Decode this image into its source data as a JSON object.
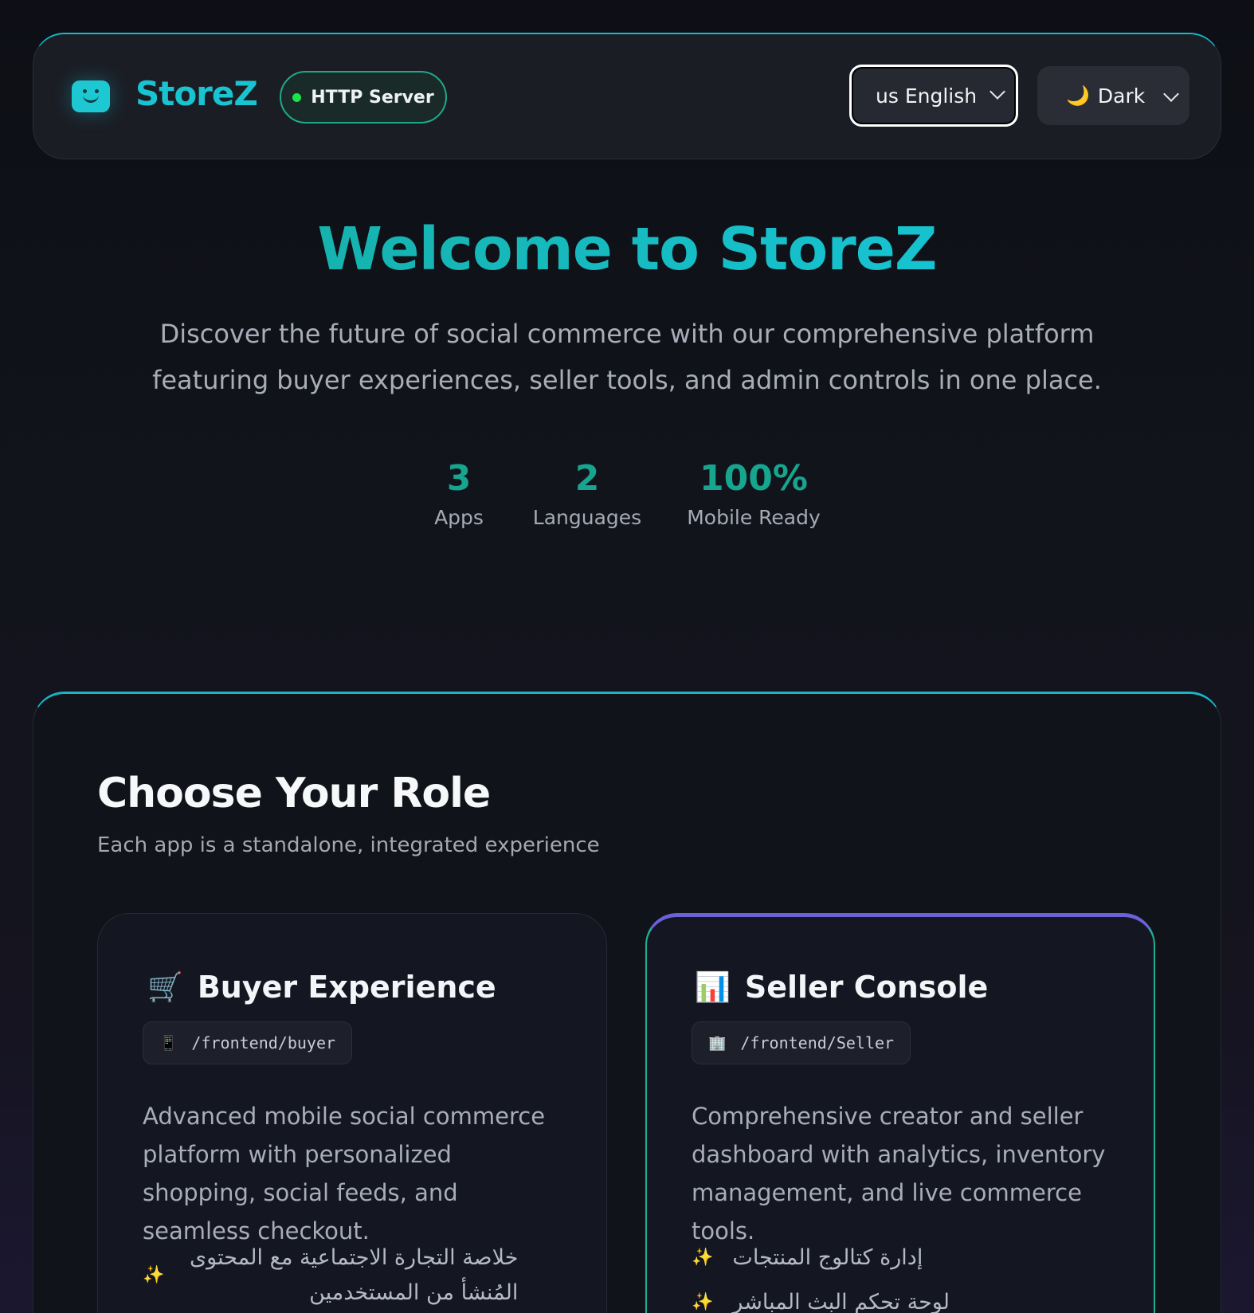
{
  "header": {
    "brand": "StoreZ",
    "server_label": "HTTP Server",
    "language_select": "us English",
    "theme_select": "Dark"
  },
  "hero": {
    "title": "Welcome to StoreZ",
    "subtitle_line1": "Discover the future of social commerce with our comprehensive platform",
    "subtitle_line2": "featuring buyer experiences, seller tools, and admin controls in one place.",
    "stats": [
      {
        "value": "3",
        "label": "Apps"
      },
      {
        "value": "2",
        "label": "Languages"
      },
      {
        "value": "100%",
        "label": "Mobile Ready"
      }
    ]
  },
  "roles": {
    "title": "Choose Your Role",
    "subtitle": "Each app is a standalone, integrated experience",
    "cards": [
      {
        "icon": "shopping-cart-icon",
        "title": "Buyer Experience",
        "path_icon": "mobile-phone-icon",
        "path": "/frontend/buyer",
        "description": "Advanced mobile social commerce platform with personalized shopping, social feeds, and seamless checkout.",
        "features": [
          "خلاصة التجارة الاجتماعية مع المحتوى المُنشأ من المستخدمين"
        ]
      },
      {
        "icon": "bar-chart-icon",
        "title": "Seller Console",
        "path_icon": "office-building-icon",
        "path": "/frontend/Seller",
        "description": "Comprehensive creator and seller dashboard with analytics, inventory management, and live commerce tools.",
        "features": [
          "إدارة كتالوج المنتجات",
          "لوحة تحكم البث المباشر"
        ]
      }
    ]
  },
  "colors": {
    "accent": "#19c3cf",
    "accent_green": "#17a58f",
    "server_online": "#1ee24a"
  }
}
